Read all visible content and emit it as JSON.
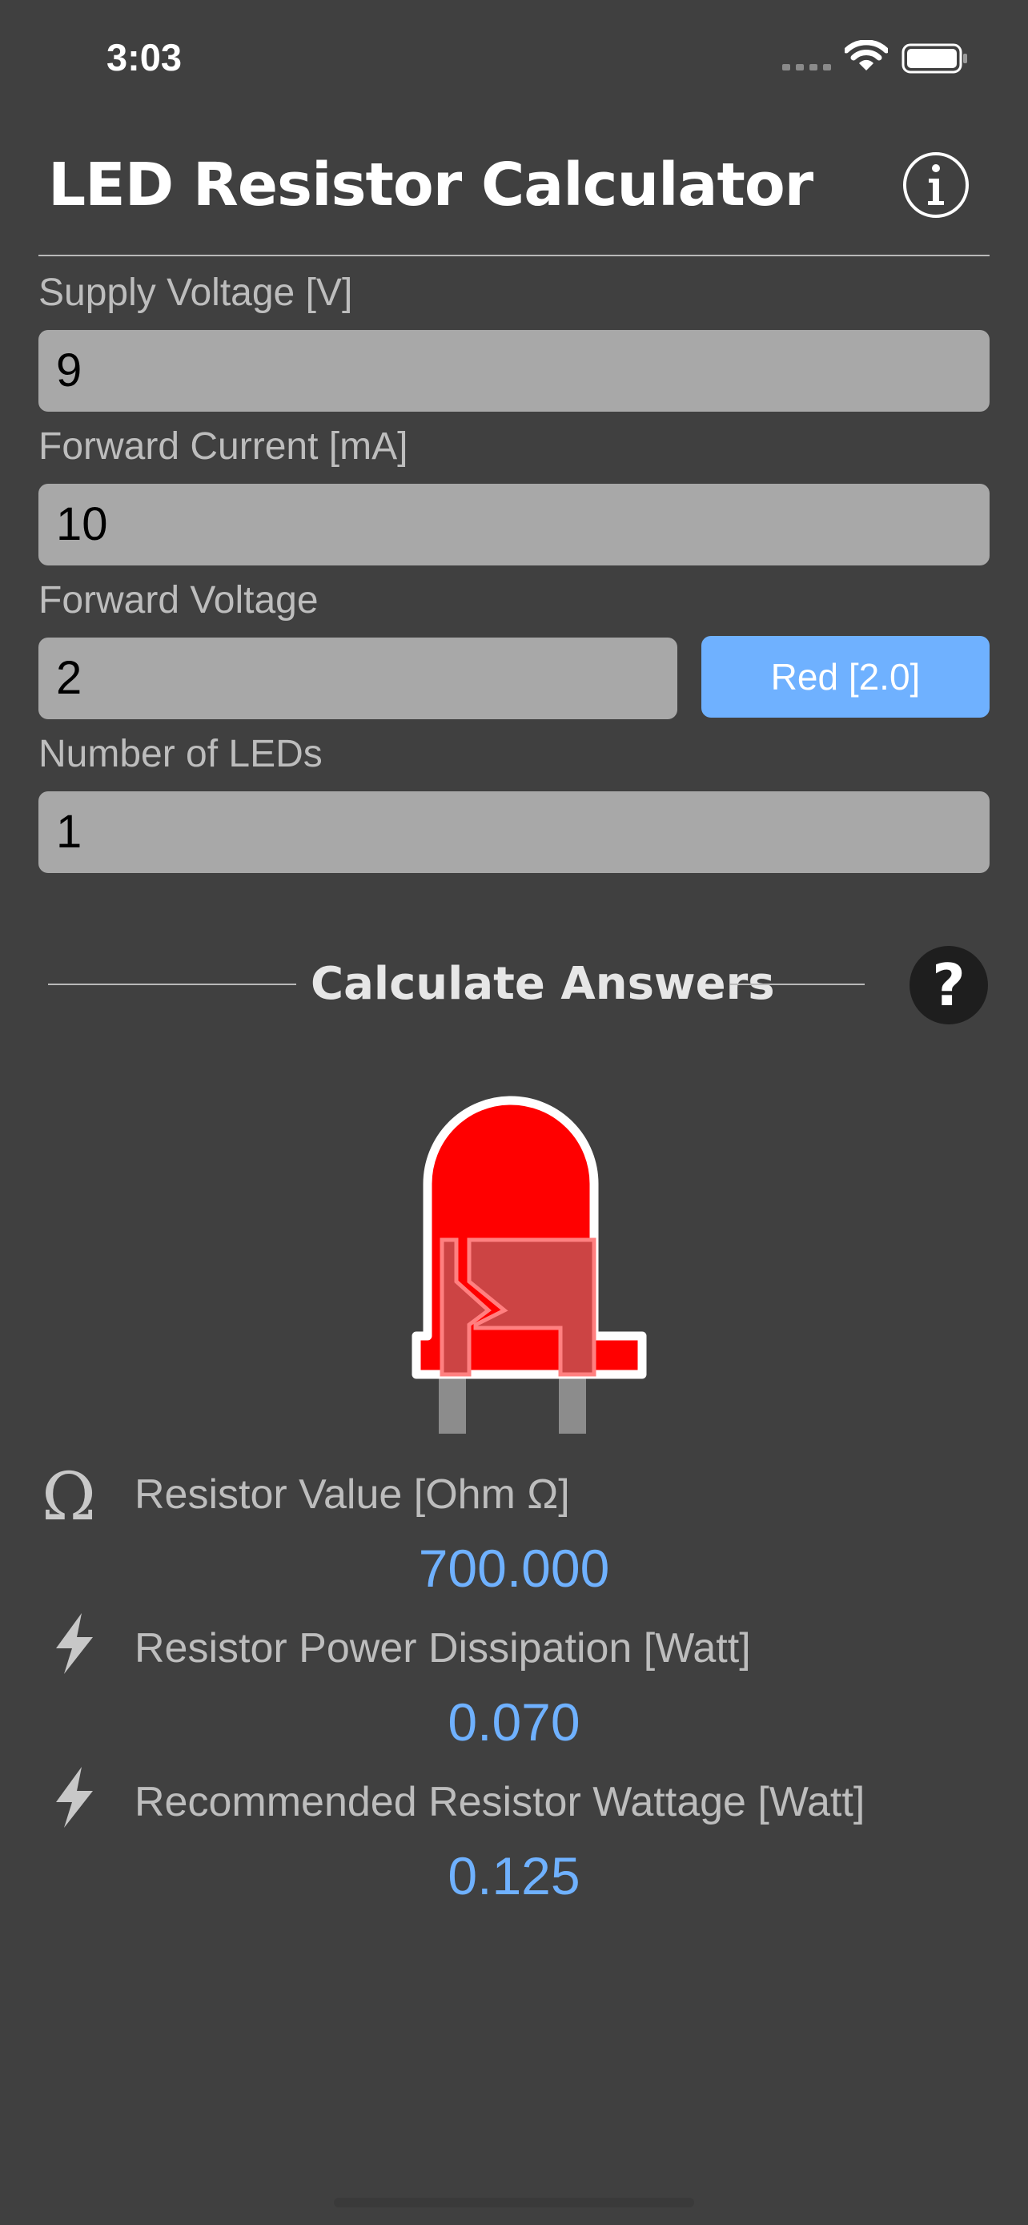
{
  "status_bar": {
    "time": "3:03"
  },
  "header": {
    "title": "LED Resistor Calculator",
    "info_icon": "info-circle-icon"
  },
  "form": {
    "supply_voltage": {
      "label": "Supply Voltage [V]",
      "value": "9"
    },
    "forward_current": {
      "label": "Forward Current [mA]",
      "value": "10"
    },
    "forward_voltage": {
      "label": "Forward Voltage",
      "value": "2",
      "preset_label": "Red [2.0]"
    },
    "num_leds": {
      "label": "Number of LEDs",
      "value": "1"
    }
  },
  "calculate": {
    "title": "Calculate Answers",
    "help_symbol": "?"
  },
  "led": {
    "color": "#ff0000"
  },
  "results": {
    "resistor_value": {
      "icon": "omega-icon",
      "symbol": "Ω",
      "label": "Resistor Value [Ohm Ω]",
      "value": "700.000"
    },
    "power_dissipation": {
      "icon": "lightning-icon",
      "label": "Resistor Power Dissipation [Watt]",
      "value": "0.070"
    },
    "recommended_wattage": {
      "icon": "lightning-icon",
      "label": "Recommended Resistor Wattage [Watt]",
      "value": "0.125"
    }
  },
  "colors": {
    "accent": "#6fb1ff",
    "background": "#404040",
    "input": "#a8a8a8"
  }
}
